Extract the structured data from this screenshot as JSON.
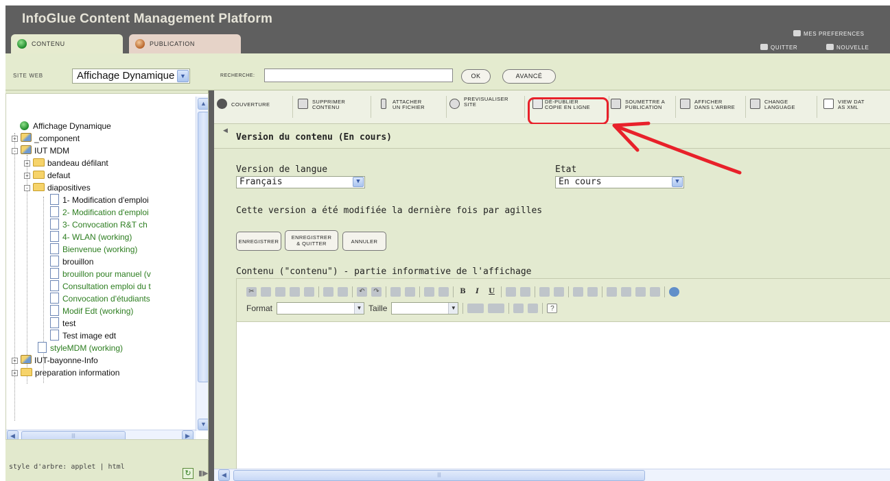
{
  "app_title": "InfoGlue Content Management Platform",
  "top_tabs": [
    {
      "label": "CONTENU",
      "icon": "green-cube-icon"
    },
    {
      "label": "PUBLICATION",
      "icon": "orange-cube-icon"
    }
  ],
  "top_links": {
    "preferences": "MES PREFERENCES",
    "quit": "QUITTER",
    "new": "NOUVELLE"
  },
  "search": {
    "site_label": "SITE WEB",
    "site_value": "Affichage Dynamique",
    "search_label": "RECHERCHE:",
    "search_value": "",
    "ok_label": "OK",
    "advanced_label": "AVANCÉ"
  },
  "tree": {
    "root": "Affichage Dynamique",
    "items": [
      {
        "label": "_component",
        "type": "site-folder",
        "expander": "+"
      },
      {
        "label": "IUT MDM",
        "type": "site-folder",
        "expander": "-"
      },
      {
        "label": "bandeau défilant",
        "type": "folder",
        "expander": "+"
      },
      {
        "label": "defaut",
        "type": "folder",
        "expander": "+"
      },
      {
        "label": "diapositives",
        "type": "folder",
        "expander": "-"
      },
      {
        "label": "1- Modification d'emploi",
        "type": "doc",
        "color": "black"
      },
      {
        "label": "2- Modification d'emploi",
        "type": "doc",
        "color": "green"
      },
      {
        "label": "3- Convocation R&T ch",
        "type": "doc",
        "color": "green"
      },
      {
        "label": "4- WLAN (working)",
        "type": "doc",
        "color": "green"
      },
      {
        "label": "Bienvenue (working)",
        "type": "doc",
        "color": "green"
      },
      {
        "label": "brouillon",
        "type": "doc",
        "color": "black"
      },
      {
        "label": "brouillon pour manuel (v",
        "type": "doc",
        "color": "green"
      },
      {
        "label": "Consultation emploi du t",
        "type": "doc",
        "color": "green"
      },
      {
        "label": "Convocation d'étudiants",
        "type": "doc",
        "color": "green"
      },
      {
        "label": "Modif Edt (working)",
        "type": "doc",
        "color": "green"
      },
      {
        "label": "test",
        "type": "doc",
        "color": "black"
      },
      {
        "label": "Test image edt",
        "type": "doc",
        "color": "black"
      },
      {
        "label": "styleMDM (working)",
        "type": "doc",
        "color": "green"
      },
      {
        "label": "IUT-bayonne-Info",
        "type": "site-folder",
        "expander": "+"
      },
      {
        "label": "preparation information",
        "type": "folder",
        "expander": "+"
      }
    ],
    "style_prefix": "style d'arbre:",
    "style_applet": "applet",
    "style_sep": "|",
    "style_html": "html"
  },
  "toolbar": {
    "items": [
      {
        "line1": "COUVERTURE",
        "line2": "",
        "icon": "cover-icon"
      },
      {
        "line1": "SUPPRIMER",
        "line2": "CONTENU",
        "icon": "trash-icon"
      },
      {
        "line1": "ATTACHER",
        "line2": "UN FICHIER",
        "icon": "paperclip-icon"
      },
      {
        "line1": "PREVISUALISER",
        "line2": "SITE",
        "icon": "eye-icon"
      },
      {
        "line1": "DÉ-PUBLIER",
        "line2": "COPIE EN LIGNE",
        "icon": "unpublish-icon"
      },
      {
        "line1": "SOUMETTRE A",
        "line2": "PUBLICATION",
        "icon": "submit-icon"
      },
      {
        "line1": "AFFICHER",
        "line2": "DANS L'ARBRE",
        "icon": "tree-icon"
      },
      {
        "line1": "CHANGE",
        "line2": "LANGUAGE",
        "icon": "language-icon"
      },
      {
        "line1": "VIEW DAT",
        "line2": "AS XML",
        "icon": "xml-icon"
      }
    ]
  },
  "version": {
    "title": "Version du contenu (En cours)",
    "lang_label": "Version de langue",
    "lang_value": "Français",
    "state_label": "Etat",
    "state_value": "En cours",
    "modified_text": "Cette version a été modifiée la dernière fois par agilles",
    "save_label": "ENREGISTRER",
    "save_quit_line1": "ENREGISTRER",
    "save_quit_line2": "& QUITTER",
    "cancel_label": "ANNULER",
    "content_label": "Contenu (\"contenu\") - partie informative de l'affichage"
  },
  "editor": {
    "format_label": "Format",
    "size_label": "Taille",
    "bold": "B",
    "italic": "I",
    "underline": "U"
  },
  "colors": {
    "header_bg": "#5f5f5f",
    "panel_bg": "#e3ead0",
    "highlight": "#e8212a",
    "green_text": "#2c7d1f"
  }
}
